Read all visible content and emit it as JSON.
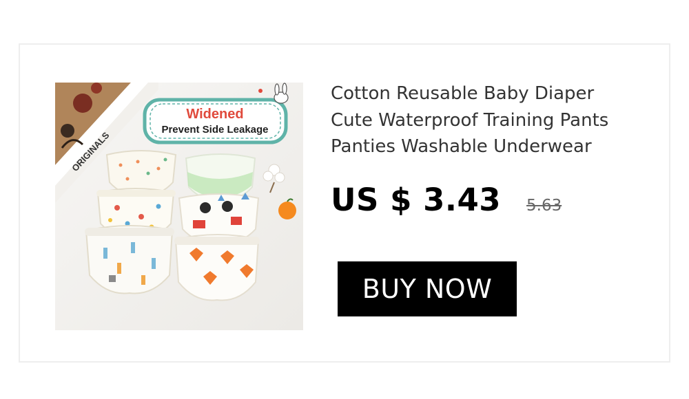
{
  "product": {
    "title_lines": [
      "Cotton Reusable Baby Diaper",
      "Cute Waterproof Training Pants",
      "Panties Washable Underwear"
    ],
    "price": "US $ 3.43",
    "original_price": "5.63",
    "buy_label": "BUY NOW"
  },
  "image": {
    "badge_title": "Widened",
    "badge_subtitle": "Prevent Side Leakage",
    "box_text": "ORIGINALS"
  },
  "colors": {
    "badge_border": "#5fb3a8",
    "badge_title": "#e04a3c",
    "button_bg": "#000000",
    "button_text": "#ffffff"
  }
}
